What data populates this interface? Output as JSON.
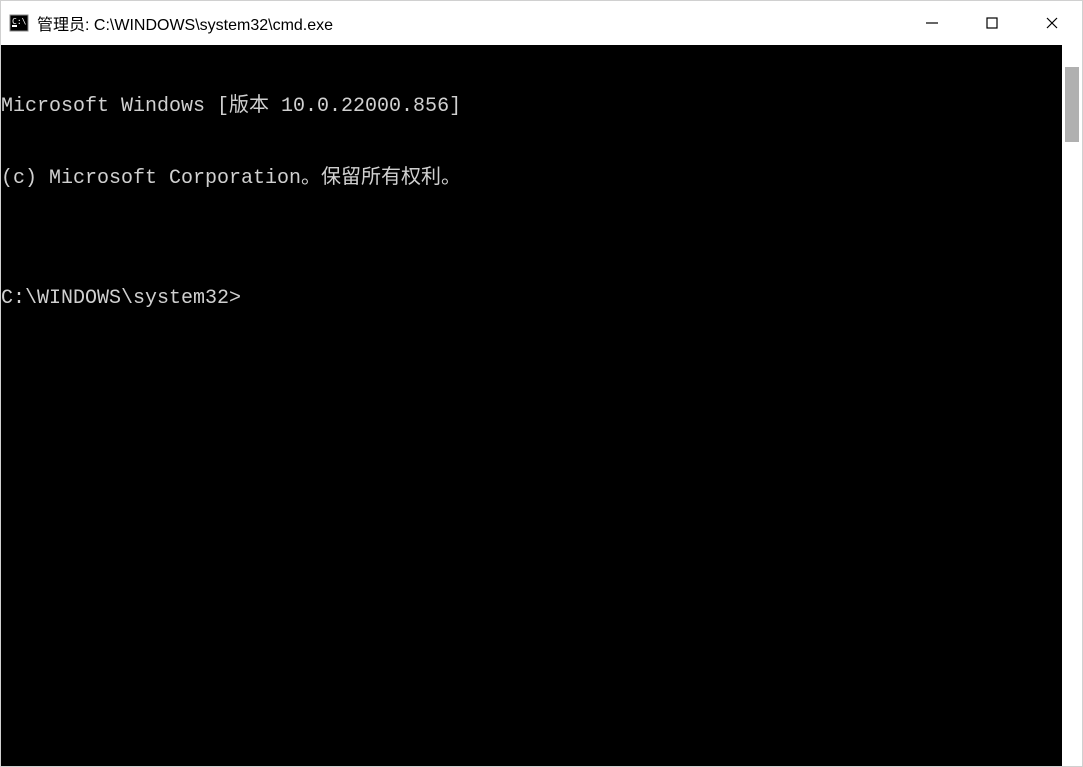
{
  "window": {
    "title": "管理员: C:\\WINDOWS\\system32\\cmd.exe"
  },
  "terminal": {
    "line1": "Microsoft Windows [版本 10.0.22000.856]",
    "line2": "(c) Microsoft Corporation。保留所有权利。",
    "blank": "",
    "prompt": "C:\\WINDOWS\\system32>",
    "input": ""
  }
}
